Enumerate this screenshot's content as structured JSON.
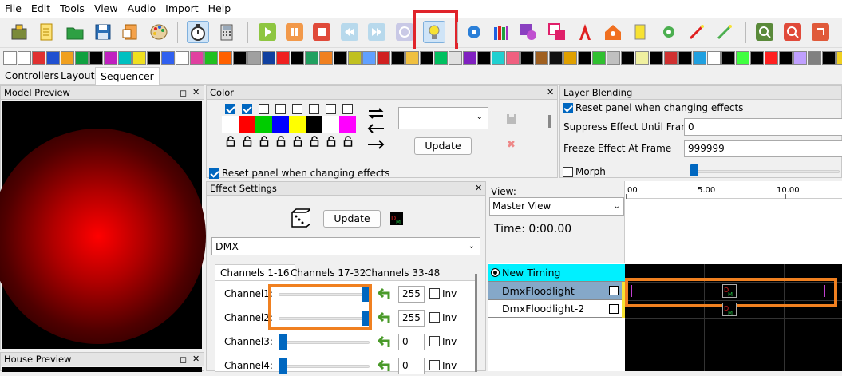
{
  "menubar": {
    "items": [
      "File",
      "Edit",
      "Tools",
      "View",
      "Audio",
      "Import",
      "Help"
    ]
  },
  "tabs": [
    "Controllers",
    "Layout",
    "Sequencer"
  ],
  "model_preview": {
    "title": "Model Preview"
  },
  "house_preview": {
    "title": "House Preview"
  },
  "color_panel": {
    "title": "Color",
    "palette_colors": [
      "#ffffff",
      "#ff0000",
      "#00cc00",
      "#0000ff",
      "#ffff00",
      "#000000",
      "#ffffff",
      "#ff00ff"
    ],
    "palette_checked": [
      true,
      true,
      false,
      false,
      false,
      false,
      false,
      false
    ],
    "update_label": "Update",
    "reset_label": "Reset panel when changing effects"
  },
  "layer_blending": {
    "title": "Layer Blending",
    "reset_label": "Reset panel when changing effects",
    "suppress_label": "Suppress Effect Until Frame",
    "suppress_value": "0",
    "freeze_label": "Freeze Effect At Frame",
    "freeze_value": "999999",
    "morph_label": "Morph"
  },
  "effect_settings": {
    "title": "Effect Settings",
    "update_label": "Update",
    "effect_name": "DMX",
    "tabs": [
      "Channels 1-16",
      "Channels 17-32",
      "Channels 33-48"
    ],
    "channels": [
      {
        "label": "Channel1:",
        "value": "255",
        "level": 1.0,
        "inv": "Inv"
      },
      {
        "label": "Channel2:",
        "value": "255",
        "level": 1.0,
        "inv": "Inv"
      },
      {
        "label": "Channel3:",
        "value": "0",
        "level": 0.0,
        "inv": "Inv"
      },
      {
        "label": "Channel4:",
        "value": "0",
        "level": 0.0,
        "inv": "Inv"
      }
    ]
  },
  "sequencer": {
    "view_label": "View:",
    "view_value": "Master View",
    "time_label": "Time: 0:00.00",
    "ruler": [
      "00",
      "5.00",
      "10.00"
    ],
    "rows": [
      {
        "label": "New Timing",
        "type": "timing"
      },
      {
        "label": "DmxFloodlight",
        "type": "model",
        "selected": true
      },
      {
        "label": "DmxFloodlight-2",
        "type": "model",
        "selected": false
      }
    ]
  },
  "colors": {
    "accent": "#0067c0",
    "highlight_red": "#e0242b",
    "highlight_orange": "#f08020",
    "timing_cyan": "#00f0ff"
  }
}
